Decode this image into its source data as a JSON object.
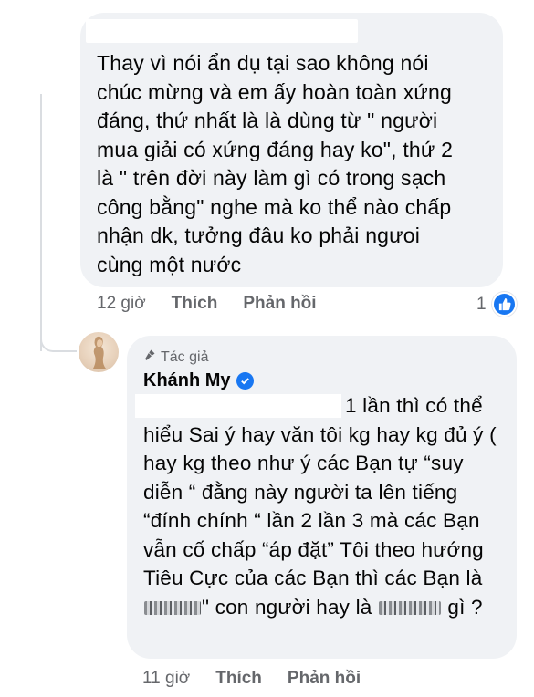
{
  "comment1": {
    "text": "Thay vì nói ẩn dụ tại sao không nói\nchúc mừng và em ấy hoàn toàn xứng\nđáng, thứ nhất là là dùng từ \" người\nmua giải có xứng đáng hay ko\", thứ 2\nlà \" trên đời này làm gì có trong sạch\ncông bằng\" nghe mà ko thể nào chấp\nnhận dk, tưởng đâu ko phải ngưoi\ncùng một nước",
    "time": "12 giờ",
    "like_label": "Thích",
    "reply_label": "Phản hồi",
    "reaction_count": "1",
    "reaction_icon": "like-icon",
    "reaction_color": "#1877f2"
  },
  "reply": {
    "author_badge": "Tác giả",
    "author_name": "Khánh My",
    "text_part1": "1 lần thì có thể hiểu Sai ý hay văn tôi kg hay kg đủ ý ( hay kg theo như ý các Bạn tự “suy diễn “ đằng này người ta lên tiếng “đính chính “ lần 2 lần 3 mà các Bạn vẫn cố chấp “áp đặt” Tôi theo hướng Tiêu Cực của các Bạn thì các Bạn là ",
    "text_part2": "\" con người hay là ",
    "text_part3": " gì ?",
    "time": "11 giờ",
    "like_label": "Thích",
    "reply_label": "Phản hồi"
  }
}
